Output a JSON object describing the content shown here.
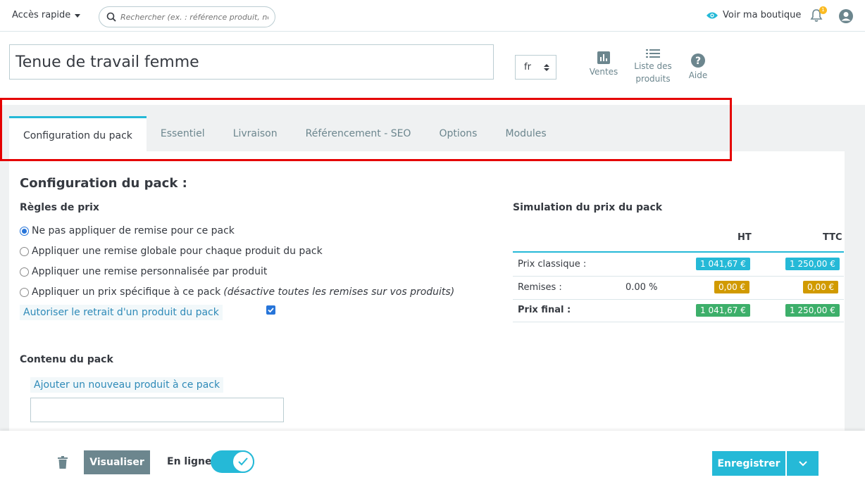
{
  "topbar": {
    "quick_access": "Accès rapide",
    "search_placeholder": "Rechercher (ex. : référence produit, nom",
    "view_shop": "Voir ma boutique",
    "notifications_count": "1"
  },
  "header": {
    "product_name": "Tenue de travail femme",
    "language": "fr",
    "tools": [
      {
        "label": "Ventes",
        "icon": "bar-chart-icon"
      },
      {
        "label": "Liste des produits",
        "icon": "list-icon"
      },
      {
        "label": "Aide",
        "icon": "help-icon"
      }
    ]
  },
  "tabs": [
    {
      "label": "Configuration du pack",
      "active": true
    },
    {
      "label": "Essentiel",
      "active": false
    },
    {
      "label": "Livraison",
      "active": false
    },
    {
      "label": "Référencement - SEO",
      "active": false
    },
    {
      "label": "Options",
      "active": false
    },
    {
      "label": "Modules",
      "active": false
    }
  ],
  "pack": {
    "title": "Configuration du pack :",
    "price_rules_title": "Règles de prix",
    "price_rules": [
      {
        "label": "Ne pas appliquer de remise pour ce pack",
        "note": "",
        "selected": true
      },
      {
        "label": "Appliquer une remise globale pour chaque produit du pack",
        "note": "",
        "selected": false
      },
      {
        "label": "Appliquer une remise personnalisée par produit",
        "note": "",
        "selected": false
      },
      {
        "label": "Appliquer un prix spécifique à ce pack",
        "note": "(désactive toutes les remises sur vos produits)",
        "selected": false
      }
    ],
    "allow_remove_label": "Autoriser le retrait d'un produit du pack",
    "allow_remove_checked": true,
    "content_title": "Contenu du pack",
    "add_product_label": "Ajouter un nouveau produit à ce pack"
  },
  "simulation": {
    "title": "Simulation du prix du pack",
    "col_ht": "HT",
    "col_ttc": "TTC",
    "rows": [
      {
        "label": "Prix classique :",
        "extra": "",
        "ht": "1 041,67 €",
        "ttc": "1 250,00 €",
        "color": "#25b9d7"
      },
      {
        "label": "Remises :",
        "extra": "0.00 %",
        "ht": "0,00 €",
        "ttc": "0,00 €",
        "color": "#d19a00"
      },
      {
        "label": "Prix final :",
        "extra": "",
        "ht": "1 041,67 €",
        "ttc": "1 250,00 €",
        "color": "#3daf6a"
      }
    ]
  },
  "footer": {
    "preview_label": "Visualiser",
    "online_label": "En ligne",
    "online_enabled": true,
    "save_label": "Enregistrer"
  },
  "colors": {
    "accent": "#25b9d7",
    "highlight_frame": "#e50000"
  }
}
